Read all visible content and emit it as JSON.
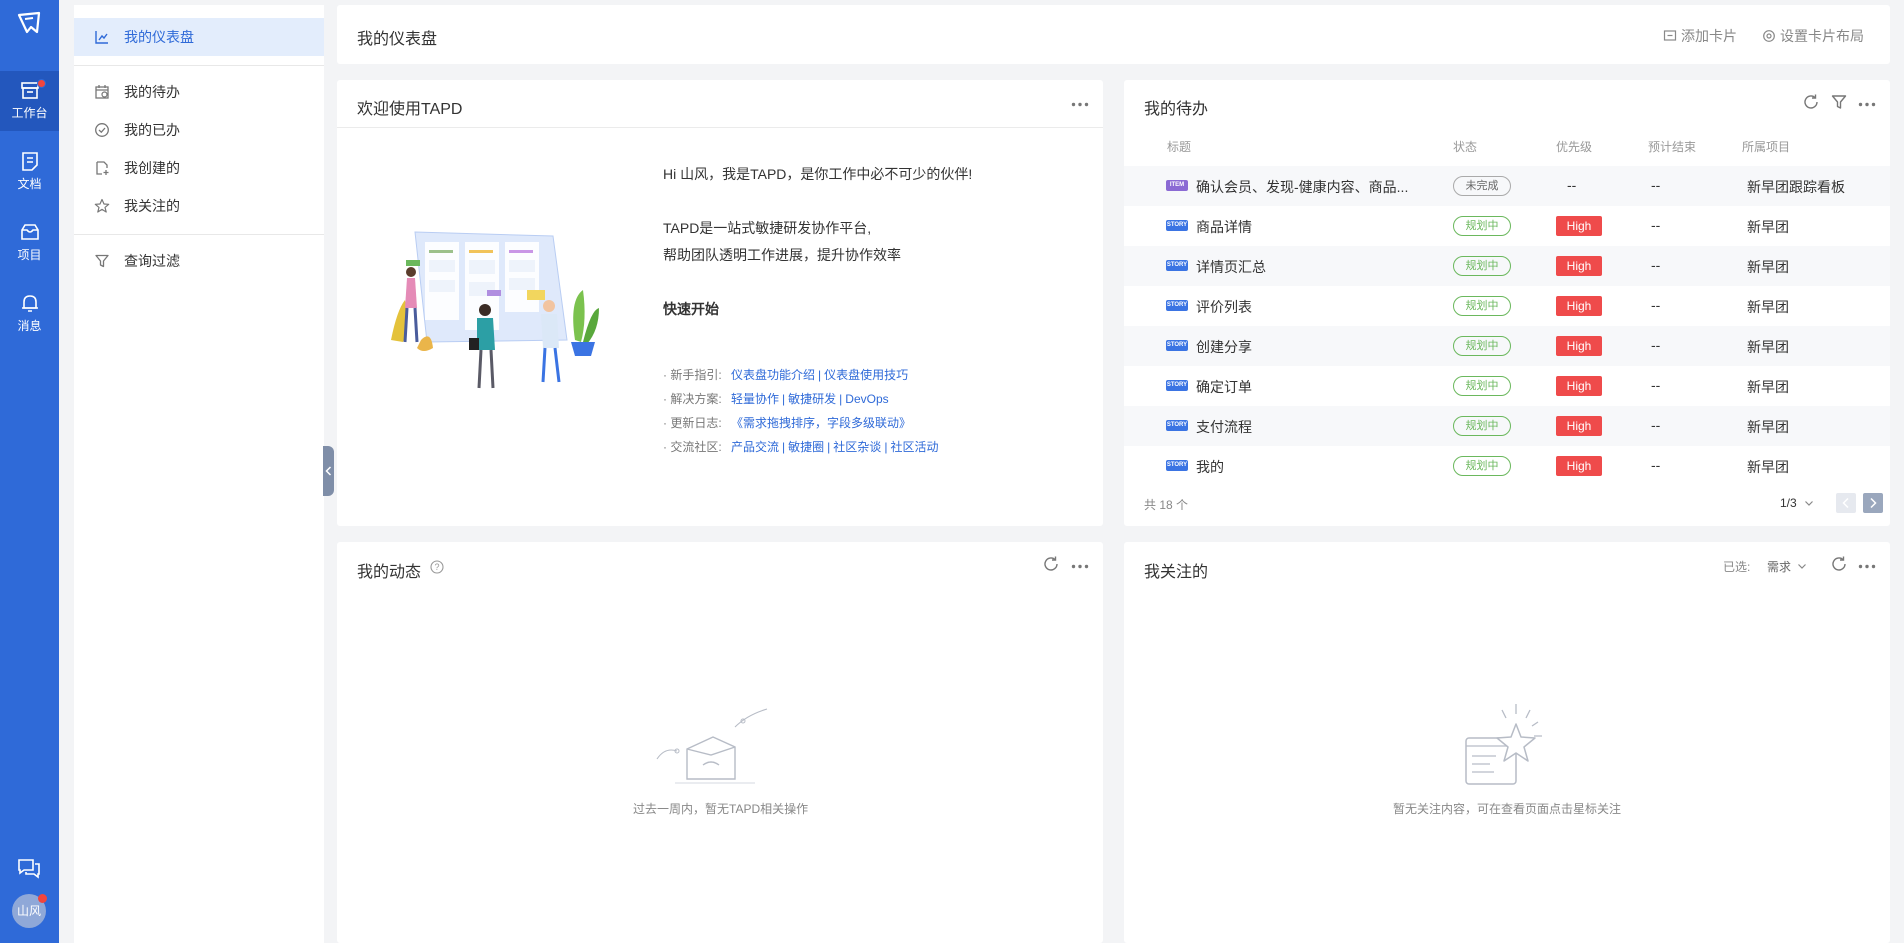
{
  "nav_rail": {
    "items": [
      {
        "label": "工作台",
        "icon": "workbench-icon",
        "active": true,
        "has_badge": true
      },
      {
        "label": "文档",
        "icon": "document-icon"
      },
      {
        "label": "项目",
        "icon": "project-icon"
      },
      {
        "label": "消息",
        "icon": "bell-icon"
      }
    ],
    "avatar_text": "山风"
  },
  "side_menu": {
    "items": [
      {
        "label": "我的仪表盘",
        "icon": "dashboard-chart-icon",
        "active": true
      },
      {
        "label": "我的待办",
        "icon": "todo-calendar-icon"
      },
      {
        "label": "我的已办",
        "icon": "check-circle-icon"
      },
      {
        "label": "我创建的",
        "icon": "create-doc-icon"
      },
      {
        "label": "我关注的",
        "icon": "star-icon"
      },
      {
        "label": "查询过滤",
        "icon": "filter-icon"
      }
    ]
  },
  "topbar": {
    "title": "我的仪表盘",
    "add_card": "添加卡片",
    "layout": "设置卡片布局"
  },
  "welcome": {
    "title": "欢迎使用TAPD",
    "greeting": "Hi 山风，我是TAPD，是你工作中必不可少的伙伴!",
    "intro1": "TAPD是一站式敏捷研发协作平台,",
    "intro2": "帮助团队透明工作进展，提升协作效率",
    "quick_start": "快速开始",
    "links": [
      {
        "prefix": "· 新手指引:",
        "items": [
          "仪表盘功能介绍",
          "仪表盘使用技巧"
        ]
      },
      {
        "prefix": "· 解决方案:",
        "items": [
          "轻量协作",
          "敏捷研发",
          "DevOps"
        ]
      },
      {
        "prefix": "· 更新日志:",
        "items": [
          "《需求拖拽排序，字段多级联动》"
        ]
      },
      {
        "prefix": "· 交流社区:",
        "items": [
          "产品交流",
          "敏捷圈",
          "社区杂谈",
          "社区活动"
        ]
      }
    ]
  },
  "todo": {
    "title": "我的待办",
    "columns": [
      "标题",
      "状态",
      "优先级",
      "预计结束",
      "所属项目"
    ],
    "rows": [
      {
        "tag": "ITEM",
        "title": "确认会员、发现-健康内容、商品...",
        "status": "未完成",
        "priority": "--",
        "end": "--",
        "project": "新早团跟踪看板"
      },
      {
        "tag": "STORY",
        "title": "商品详情",
        "status": "规划中",
        "priority": "High",
        "end": "--",
        "project": "新早团"
      },
      {
        "tag": "STORY",
        "title": "详情页汇总",
        "status": "规划中",
        "priority": "High",
        "end": "--",
        "project": "新早团"
      },
      {
        "tag": "STORY",
        "title": "评价列表",
        "status": "规划中",
        "priority": "High",
        "end": "--",
        "project": "新早团"
      },
      {
        "tag": "STORY",
        "title": "创建分享",
        "status": "规划中",
        "priority": "High",
        "end": "--",
        "project": "新早团"
      },
      {
        "tag": "STORY",
        "title": "确定订单",
        "status": "规划中",
        "priority": "High",
        "end": "--",
        "project": "新早团"
      },
      {
        "tag": "STORY",
        "title": "支付流程",
        "status": "规划中",
        "priority": "High",
        "end": "--",
        "project": "新早团"
      },
      {
        "tag": "STORY",
        "title": "我的",
        "status": "规划中",
        "priority": "High",
        "end": "--",
        "project": "新早团"
      }
    ],
    "total": "共 18 个",
    "page": "1/3"
  },
  "activity": {
    "title": "我的动态",
    "empty": "过去一周内，暂无TAPD相关操作"
  },
  "follow": {
    "title": "我关注的",
    "selected_label": "已选:",
    "selected_value": "需求",
    "empty": "暂无关注内容，可在查看页面点击星标关注"
  },
  "colors": {
    "primary": "#2f6ad8",
    "high": "#ef4b4b",
    "planning": "#6bb85d"
  }
}
